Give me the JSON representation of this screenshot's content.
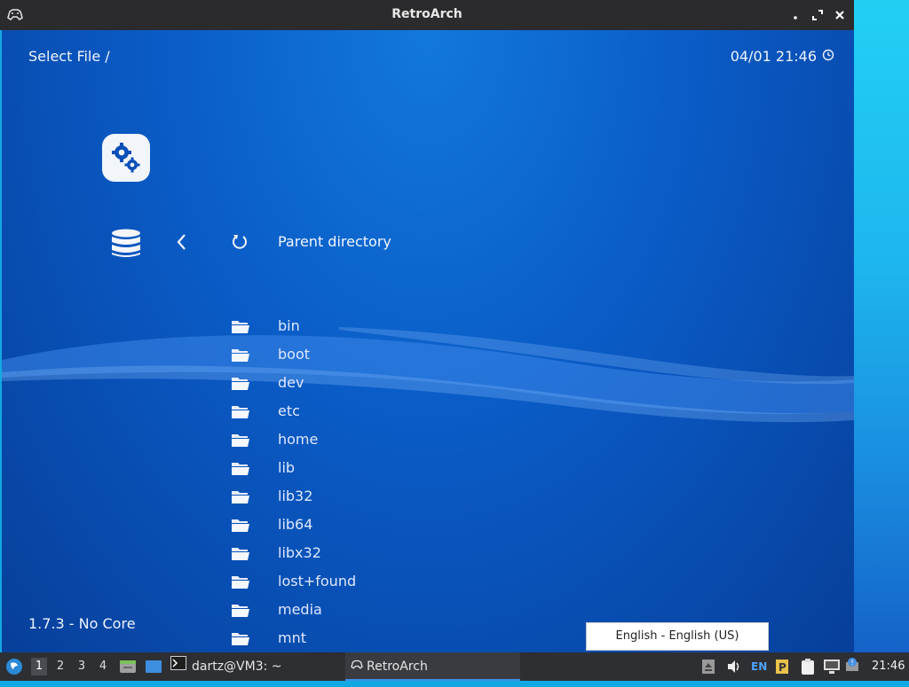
{
  "window": {
    "title": "RetroArch"
  },
  "header": {
    "location": "Select File /",
    "datetime": "04/01 21:46"
  },
  "menu": {
    "parent_label": "Parent directory",
    "entries": [
      {
        "label": "bin"
      },
      {
        "label": "boot"
      },
      {
        "label": "dev"
      },
      {
        "label": "etc"
      },
      {
        "label": "home"
      },
      {
        "label": "lib"
      },
      {
        "label": "lib32"
      },
      {
        "label": "lib64"
      },
      {
        "label": "libx32"
      },
      {
        "label": "lost+found"
      },
      {
        "label": "media"
      },
      {
        "label": "mnt"
      }
    ]
  },
  "footer": {
    "version": "1.7.3 - No Core"
  },
  "language_popup": {
    "label": "English - English (US)"
  },
  "taskbar": {
    "workspaces": [
      "1",
      "2",
      "3",
      "4"
    ],
    "terminal_task": "dartz@VM3: ~",
    "retroarch_task": "RetroArch",
    "keyboard_layout": "EN",
    "clock": "21:46"
  },
  "colors": {
    "accent": "#0a5bc6",
    "titlebar": "#2b2b2e",
    "taskbar": "#2e2f33"
  },
  "icons": [
    "gamepad-icon",
    "settings-gears-icon",
    "database-icon",
    "chevron-left-icon",
    "refresh-icon",
    "folder-icon",
    "clock-icon",
    "volume-icon",
    "network-icon"
  ]
}
